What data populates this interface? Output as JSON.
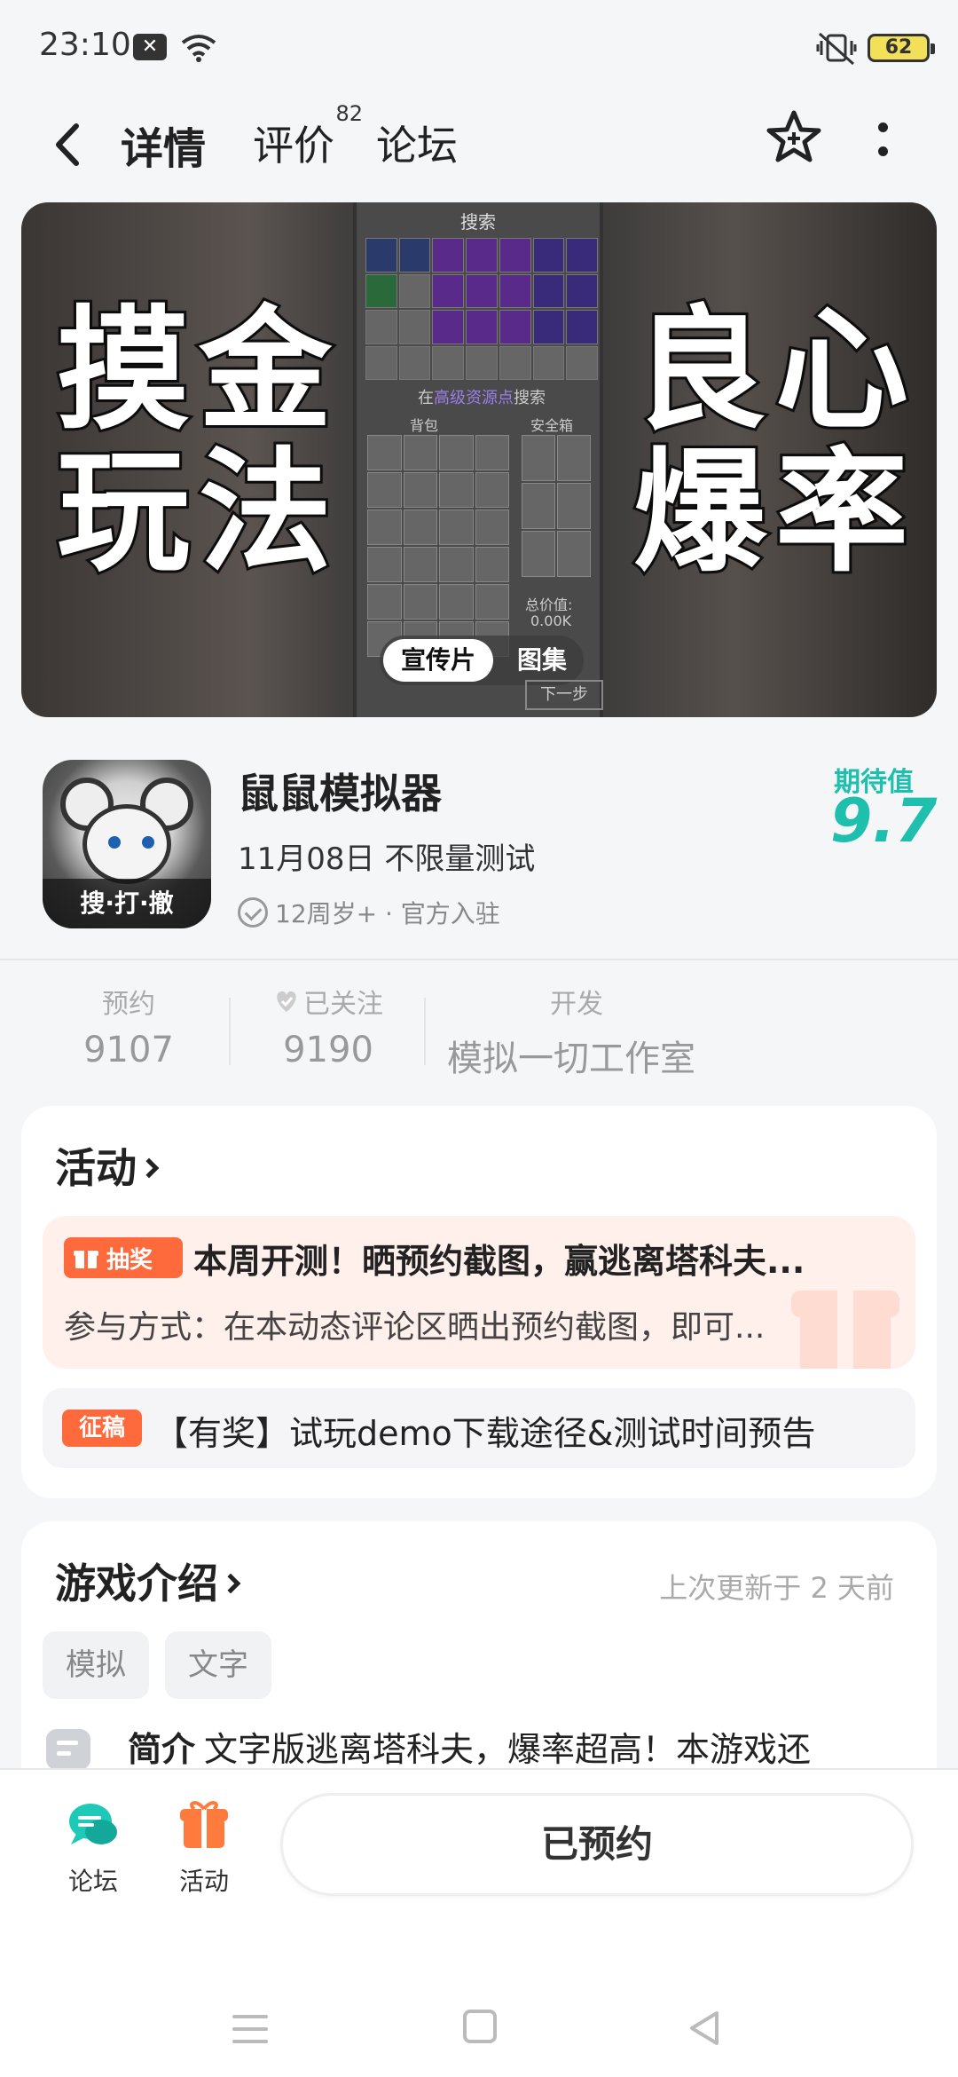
{
  "status_bar": {
    "time": "23:10",
    "notification_icon": "x-icon",
    "wifi_icon": "wifi-icon",
    "mute_icon": "vibrate-off-icon",
    "battery": "62"
  },
  "header": {
    "tabs": [
      {
        "label": "详情",
        "active": true
      },
      {
        "label": "评价",
        "badge": "82"
      },
      {
        "label": "论坛"
      }
    ],
    "accent_color": "#1fc9b8"
  },
  "banner": {
    "left_text": [
      "摸金",
      "玩法"
    ],
    "right_text": [
      "良心",
      "爆率"
    ],
    "panel_title": "搜索",
    "search_prefix": "在",
    "search_highlight": "高级资源点",
    "search_suffix": "搜索",
    "bag_label": "背包",
    "safe_label": "安全箱",
    "total_label": "总价值:",
    "total_value": "0.00K",
    "next_label": "下一步",
    "media_tabs": [
      "宣传片",
      "图集"
    ]
  },
  "game": {
    "name": "鼠鼠模拟器",
    "release": "11月08日 不限量测试",
    "meta": "12周岁+ · 官方入驻",
    "icon_tagline": "搜·打·撤",
    "expect_label": "期待值",
    "expect_value": "9.7"
  },
  "stats": [
    {
      "label": "预约",
      "value": "9107"
    },
    {
      "label": "已关注",
      "value": "9190"
    },
    {
      "label": "开发",
      "value": "模拟一切工作室"
    }
  ],
  "activity": {
    "title": "活动",
    "main_badge": "抽奖",
    "main_title": "本周开测！晒预约截图，赢逃离塔科夫...",
    "main_desc": "参与方式：在本动态评论区晒出预约截图，即可...",
    "second_badge": "征稿",
    "second_title": "【有奖】试玩demo下载途径&测试时间预告"
  },
  "intro": {
    "title": "游戏介绍",
    "updated": "上次更新于 2 天前",
    "tags": [
      "模拟",
      "文字"
    ],
    "summary_label": "简介",
    "summary_text": "文字版逃离塔科夫，爆率超高！本游戏还"
  },
  "bottom": {
    "forum_label": "论坛",
    "activity_label": "活动",
    "reserve_label": "已预约"
  }
}
